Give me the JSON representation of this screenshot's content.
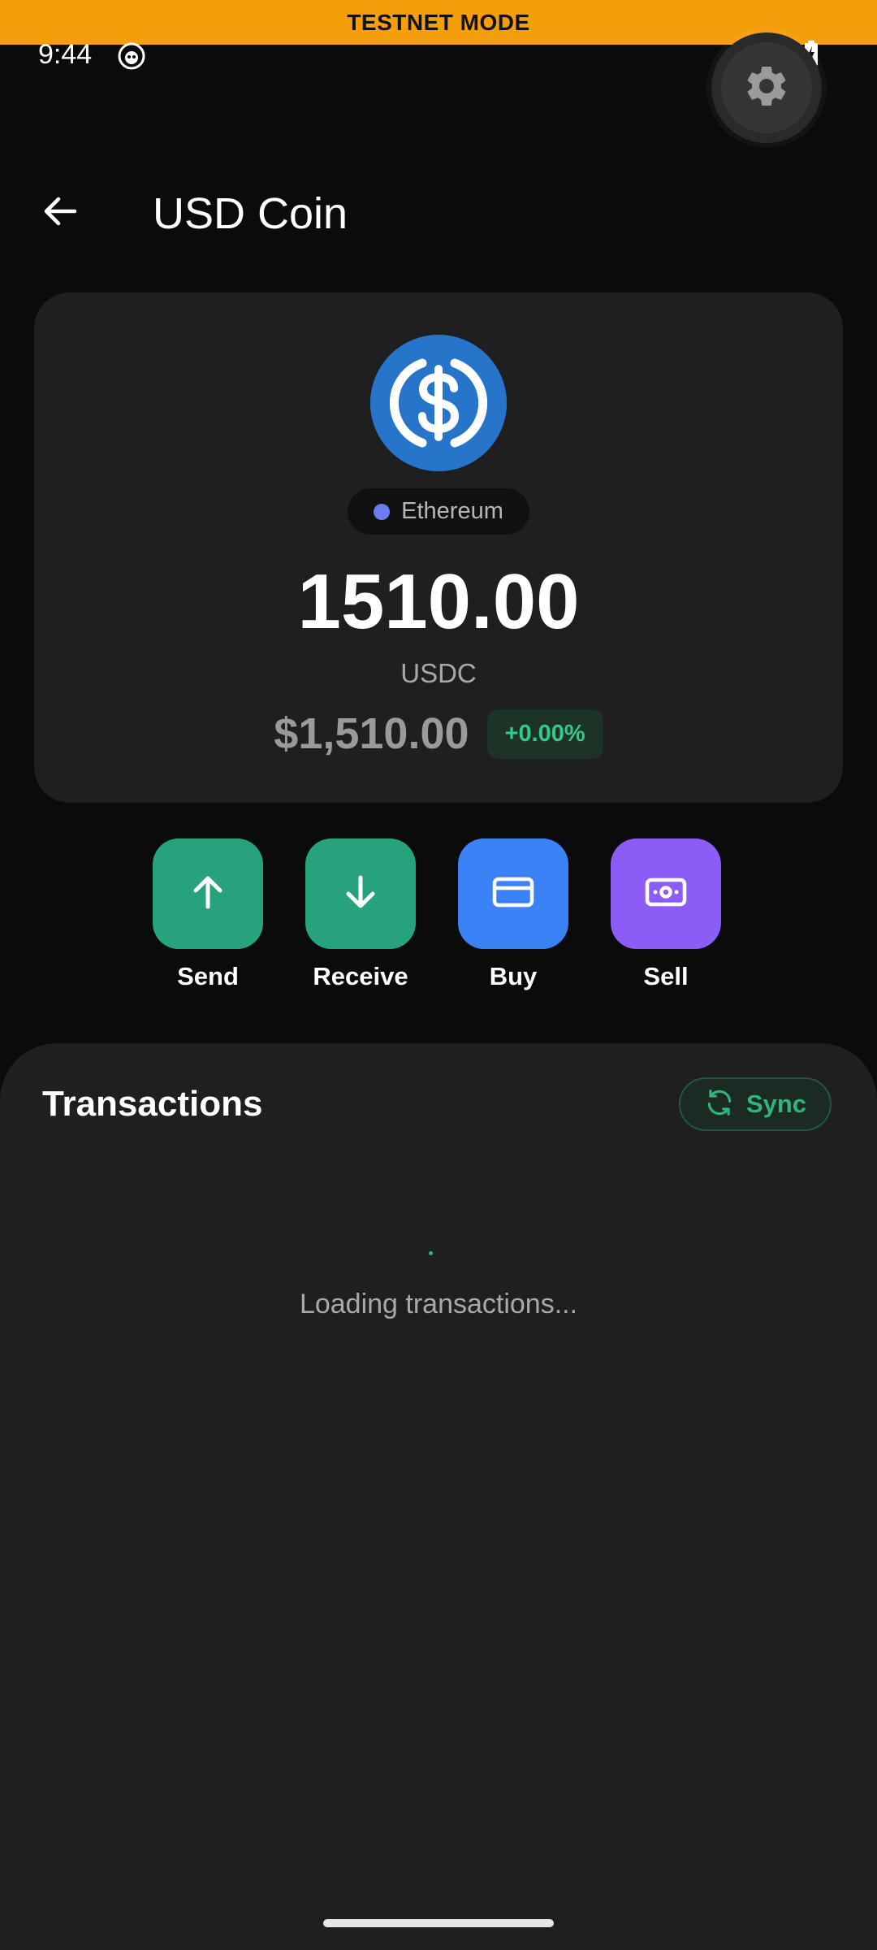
{
  "banner": {
    "text": "TESTNET MODE",
    "color": "#f59e0b"
  },
  "status_bar": {
    "time": "9:44"
  },
  "header": {
    "title": "USD Coin"
  },
  "asset": {
    "network": "Ethereum",
    "balance": "1510.00",
    "symbol": "USDC",
    "fiat_value": "$1,510.00",
    "change": "+0.00%",
    "logo_color": "#2775ca"
  },
  "actions": [
    {
      "label": "Send",
      "icon": "arrow-up-icon",
      "color": "#26a37c"
    },
    {
      "label": "Receive",
      "icon": "arrow-down-icon",
      "color": "#26a37c"
    },
    {
      "label": "Buy",
      "icon": "credit-card-icon",
      "color": "#3b82f6"
    },
    {
      "label": "Sell",
      "icon": "cash-icon",
      "color": "#8b5cf6"
    }
  ],
  "transactions": {
    "title": "Transactions",
    "sync_label": "Sync",
    "loading_text": "Loading transactions..."
  }
}
